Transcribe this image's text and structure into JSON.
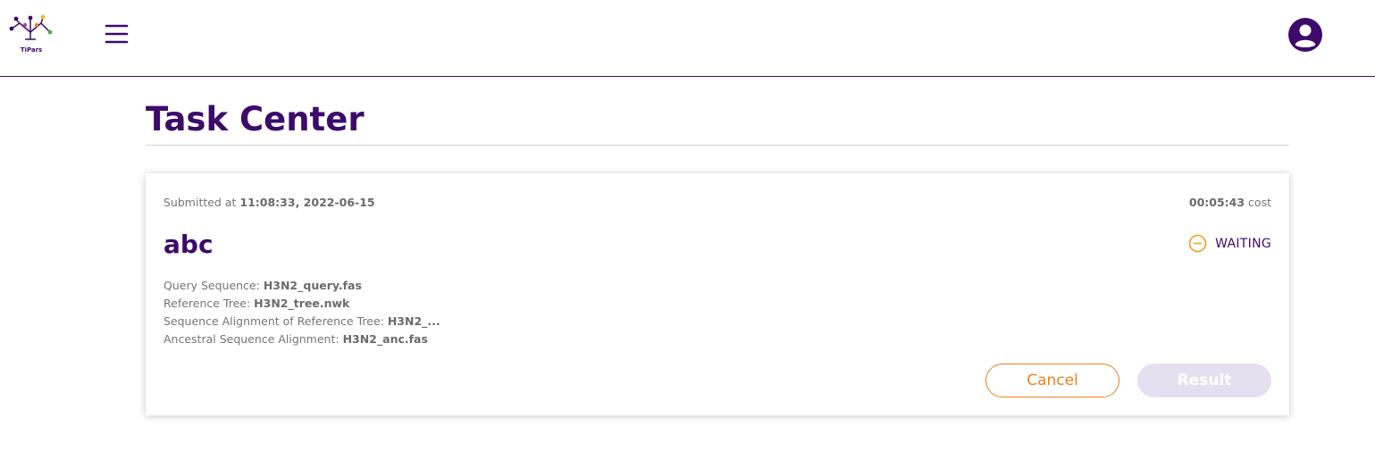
{
  "header": {
    "logo_text": "TiPars",
    "menu_icon": "hamburger-menu-icon",
    "user_icon": "account-circle-icon"
  },
  "page": {
    "title": "Task Center"
  },
  "task": {
    "submitted_prefix": "Submitted at ",
    "submitted_time": "11:08:33, 2022-06-15",
    "cost_value": "00:05:43",
    "cost_suffix": " cost",
    "name": "abc",
    "status": "WAITING",
    "status_icon": "minus-circle-icon",
    "fields": [
      {
        "label": "Query Sequence: ",
        "value": "H3N2_query.fas"
      },
      {
        "label": "Reference Tree: ",
        "value": "H3N2_tree.nwk"
      },
      {
        "label": "Sequence Alignment of Reference Tree: ",
        "value": "H3N2_..."
      },
      {
        "label": "Ancestral Sequence Alignment: ",
        "value": "H3N2_anc.fas"
      }
    ],
    "cancel_label": "Cancel",
    "result_label": "Result"
  },
  "colors": {
    "brand": "#3d0a6b",
    "accent": "#e8821e",
    "status_waiting": "#f0a020",
    "disabled_button": "#e6dfef"
  }
}
